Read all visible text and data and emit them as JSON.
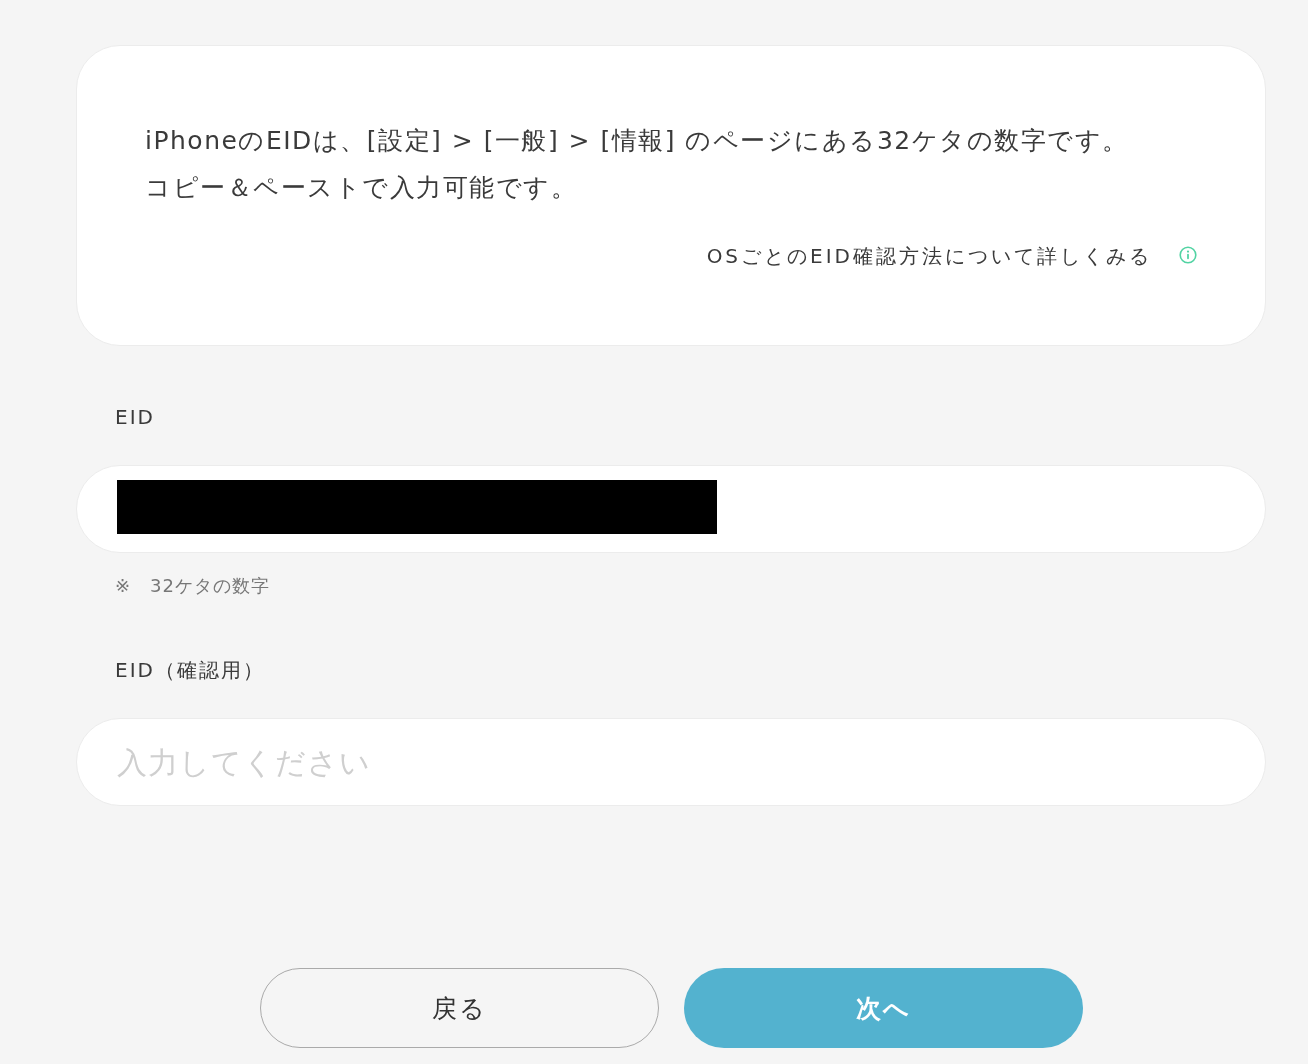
{
  "intro_card": {
    "lines": [
      "iPhoneのEIDは、[設定] > [一般] > [情報] のページにある32ケタの数字です。",
      "コピー＆ペーストで入力可能です。"
    ],
    "help_link": "OSごとのEID確認方法について詳しくみる"
  },
  "fields": [
    {
      "label": "EID",
      "redacted": true,
      "note": "※　32ケタの数字"
    },
    {
      "label": "EID（確認用）",
      "placeholder": "入力してください"
    }
  ],
  "buttons": [
    {
      "label": "戻る",
      "kind": "secondary"
    },
    {
      "label": "次へ",
      "kind": "primary"
    }
  ]
}
